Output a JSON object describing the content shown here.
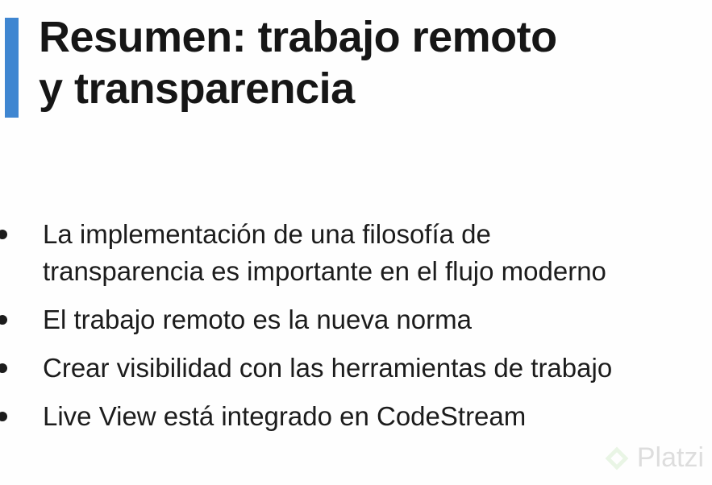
{
  "slide": {
    "title_lines": [
      "Resumen: trabajo remoto",
      "y transparencia"
    ],
    "bullets": [
      {
        "lines": [
          "La implementación de una filosofía de",
          "transparencia es importante en el flujo moderno"
        ]
      },
      {
        "lines": [
          "El trabajo remoto es la nueva norma"
        ]
      },
      {
        "lines": [
          "Crear visibilidad con las herramientas de trabajo"
        ]
      },
      {
        "lines": [
          "Live View está integrado en CodeStream"
        ]
      }
    ]
  },
  "watermark": {
    "icon": "platzi-logo-icon",
    "text": "Platzi"
  },
  "colors": {
    "accent": "#3f86d1",
    "text": "#1a1a1a",
    "background": "#ffffff"
  }
}
